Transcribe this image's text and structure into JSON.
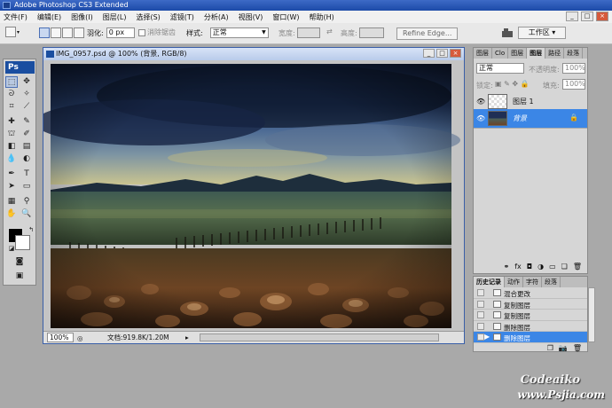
{
  "app": {
    "title": "Adobe Photoshop CS3 Extended"
  },
  "menu": [
    "文件(F)",
    "编辑(E)",
    "图像(I)",
    "图层(L)",
    "选择(S)",
    "滤镜(T)",
    "分析(A)",
    "视图(V)",
    "窗口(W)",
    "帮助(H)"
  ],
  "options": {
    "feather_label": "羽化:",
    "feather_value": "0 px",
    "antialias_label": "消除锯齿",
    "style_label": "样式:",
    "style_value": "正常",
    "width_label": "宽度:",
    "height_label": "高度:",
    "refine_edge": "Refine Edge...",
    "workspace": "工作区"
  },
  "tools": {
    "logo": "Ps"
  },
  "document": {
    "title": "IMG_0957.psd @ 100% (背景, RGB/8)",
    "zoom": "100%",
    "docsize": "文档:919.8K/1.20M"
  },
  "layers_panel": {
    "tabs": [
      "图层",
      "Clo",
      "图层",
      "图层",
      "路径",
      "段落"
    ],
    "blend_mode": "正常",
    "opacity_label": "不透明度:",
    "opacity_value": "100%",
    "lock_label": "锁定:",
    "fill_label": "填充:",
    "fill_value": "100%",
    "layers": [
      {
        "name": "图层 1"
      },
      {
        "name": "背景"
      }
    ]
  },
  "history_panel": {
    "tabs": [
      "历史记录",
      "动作",
      "字符",
      "段落"
    ],
    "items": [
      "混合更改",
      "复制图层",
      "复制图层",
      "删除图层",
      "删除图层"
    ]
  },
  "watermark": {
    "line1": "Codeaiko",
    "line2": "www.Psjia.com"
  }
}
